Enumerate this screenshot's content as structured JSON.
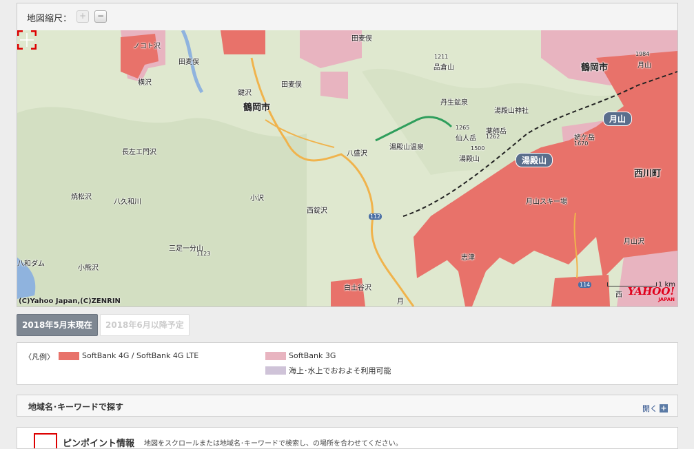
{
  "zoom": {
    "label": "地図縮尺：",
    "plus": "+",
    "minus": "−"
  },
  "map": {
    "copyright": "(C)Yahoo Japan,(C)ZENRIN",
    "scale": "1 km",
    "logo": "YAHOO!",
    "logo_sub": "JAPAN",
    "labels": {
      "notozawa": "ノコト沢",
      "tamata_mata1": "田麦俣",
      "tamata_mata2": "田麦俣",
      "tamata_mata3": "田麦俣",
      "yokozawa": "横沢",
      "jozawa": "鍵沢",
      "tsuruoka1": "鶴岡市",
      "tsuruoka2": "鶴岡市",
      "gassan_r": "月山",
      "gassan_top": "月山",
      "shinakurayama": "品倉山",
      "niu_mine": "丹生鉱泉",
      "yudonosan_shrine": "湯殿山神社",
      "yakushidake": "薬師岳",
      "sennindake": "仙人岳",
      "yudonosan": "湯殿山",
      "yudonosan_onsen": "湯殿山温泉",
      "ushigatake": "姥ケ岳",
      "yudonosan_badge": "湯殿山",
      "gassan_badge": "月山",
      "nishikawa": "西川町",
      "hachimori": "八盛沢",
      "chozaemon": "長左エ門沢",
      "yakematsu": "焼松沢",
      "hachiku": "八久和川",
      "kozawa": "小沢",
      "nishijozawa": "西錠沢",
      "sanjo": "三足一分山",
      "kumazawa": "小熊沢",
      "dam": "八和ダム",
      "shizu": "志津",
      "gassan_ski": "月山スキー場",
      "gassanzawa": "月山沢",
      "shirotsuchi": "白土谷沢",
      "route112": "112",
      "route114": "114",
      "elev1211": "1211",
      "elev1984": "1984",
      "elev1265": "1265",
      "elev1262": "1262",
      "elev1500": "1500",
      "elev1670": "1670",
      "elev1123": "1123",
      "tsuki": "月",
      "nishi": "西"
    }
  },
  "tabs": {
    "current": "2018年5月末現在",
    "future": "2018年6月以降予定"
  },
  "legend": {
    "head": "〈凡例〉",
    "items": [
      {
        "label": "SoftBank 4G / SoftBank 4G LTE",
        "color": "#e8726a"
      },
      {
        "label": "SoftBank 3G",
        "color": "#e8b4c0"
      },
      {
        "label": "海上･水上でおおよそ利用可能",
        "color": "#cfc3d8"
      }
    ]
  },
  "search": {
    "title": "地域名･キーワードで探す",
    "open": "開く",
    "open_icon": "+"
  },
  "pin": {
    "title": "ピンポイント情報",
    "desc": "地図をスクロールまたは地域名･キーワードで検索し、の場所を合わせてください。"
  }
}
